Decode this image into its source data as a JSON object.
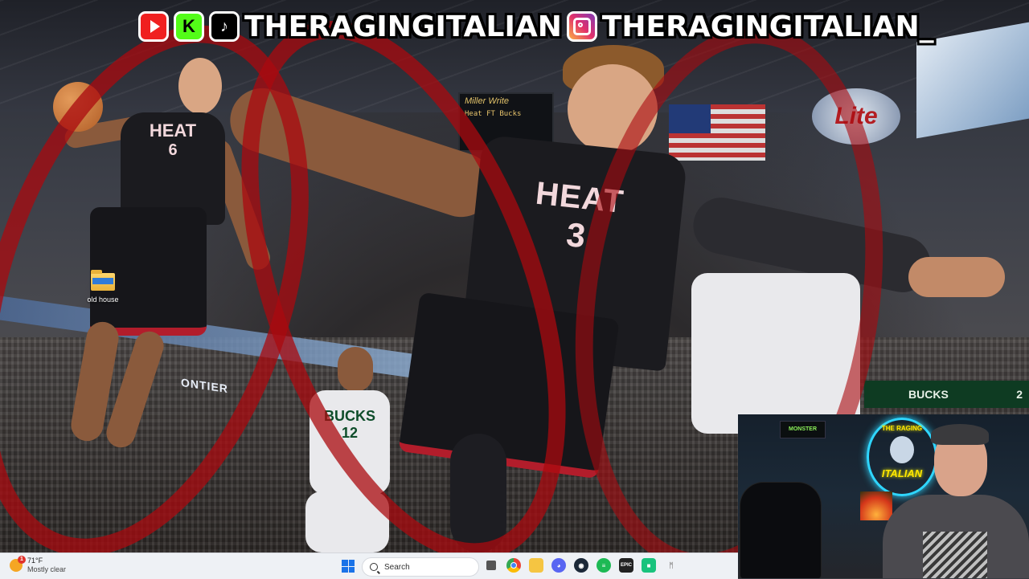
{
  "overlay": {
    "handle_1": "THERAGINGITALIAN",
    "handle_2": "THERAGINGITALIAN_",
    "icons": [
      "youtube-icon",
      "kick-icon",
      "tiktok-icon",
      "instagram-icon"
    ],
    "kick_letter": "K"
  },
  "wallpaper": {
    "arena_banner": "ONTIER",
    "scoreboard_brand": "Miller Write",
    "scoreboard_row": "Heat  FT  Bucks",
    "beer_sign": "Lite",
    "bucks_sign": "BUCKS",
    "bucks_score": "2",
    "jersey_left_team": "HEAT",
    "jersey_left_number": "6",
    "jersey_center_team": "HEAT",
    "jersey_center_number": "3",
    "jersey_bucks_team": "BUCKS",
    "jersey_bucks_number": "12"
  },
  "desktop": {
    "icons": [
      {
        "label": "old house",
        "icon": "folder-icon"
      }
    ]
  },
  "taskbar": {
    "weather_temp": "71°F",
    "weather_condition": "Mostly clear",
    "weather_alert_count": "1",
    "search_placeholder": "Search",
    "apps": [
      "task-view-icon",
      "chrome-icon",
      "file-explorer-icon",
      "discord-icon",
      "steam-icon",
      "spotify-icon",
      "epic-games-icon",
      "green-app-icon",
      "monitor-icon"
    ],
    "epic_label": "EPIC"
  },
  "webcam": {
    "monster_label": "MONSTER",
    "neon_top": "THE RAGING",
    "neon_bottom": "ITALIAN"
  },
  "colors": {
    "taskbar_bg": "#eef1f5",
    "red_swirl": "#aa0a0f",
    "heat_jersey": "#1b1b1f",
    "bucks_green": "#0e3b22"
  }
}
